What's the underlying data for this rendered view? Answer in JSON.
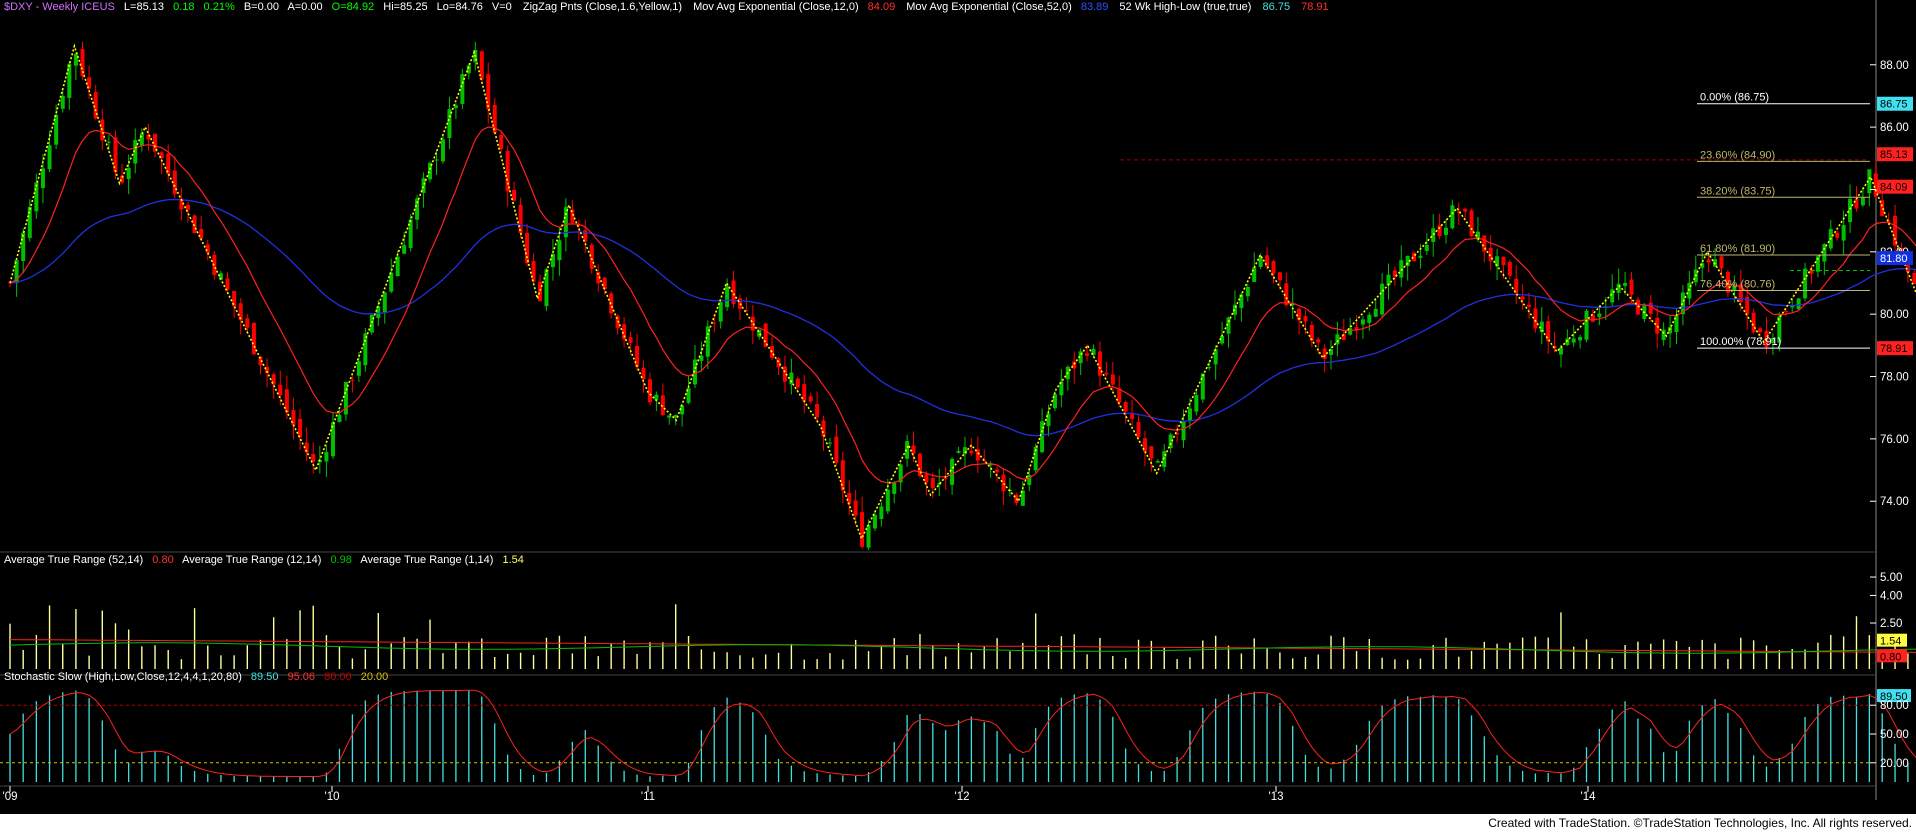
{
  "header": {
    "symbol": "$DXY - Weekly  ICEUS",
    "last": "L=85.13",
    "change": "0.18",
    "change_pct": "0.21%",
    "bid": "B=0.00",
    "ask": "A=0.00",
    "open": "O=84.92",
    "high": "Hi=85.25",
    "low": "Lo=84.76",
    "volume": "V=0",
    "zigzag": "ZigZag Pnts (Close,1.6,Yellow,1)",
    "ema12_label": "Mov Avg Exponential (Close,12,0)",
    "ema12_value": "84.09",
    "ema52_label": "Mov Avg Exponential (Close,52,0)",
    "ema52_value": "83.89",
    "hilo_label": "52 Wk High-Low (true,true)",
    "hilo_high": "86.75",
    "hilo_low": "78.91"
  },
  "atr_header": {
    "atr52_label": "Average True Range (52,14)",
    "atr52_value": "0.80",
    "atr12_label": "Average True Range (12,14)",
    "atr12_value": "0.98",
    "atr1_label": "Average True Range (1,14)",
    "atr1_value": "1.54"
  },
  "stoch_header": {
    "label": "Stochastic Slow (High,Low,Close,12,4,4,1,20,80)",
    "k_value": "89.50",
    "d_value": "95.06",
    "ob_value": "80.00",
    "os_value": "20.00"
  },
  "footer": {
    "credit": "Created with TradeStation. ©TradeStation Technologies, Inc. All rights reserved."
  },
  "colors": {
    "up_candle": "#00c000",
    "down_candle": "#ff0000",
    "ema12": "#ff2020",
    "ema52": "#2030e0",
    "zigzag": "#ffff00",
    "fib": "#bdb76b",
    "atr_bars": "#ffff99",
    "stoch": "#40e0e0"
  },
  "chart_data": [
    {
      "type": "candlestick",
      "title": "$DXY - Weekly",
      "x_ticks": [
        "'09",
        "'10",
        "'11",
        "'12",
        "'13",
        "'14"
      ],
      "ylim": [
        72.5,
        89.5
      ],
      "y_ticks": [
        "88.00",
        "86.00",
        "84.00",
        "82.00",
        "80.00",
        "78.00",
        "76.00",
        "74.00"
      ],
      "price_tags": [
        {
          "value": "86.75",
          "kind": "high"
        },
        {
          "value": "85.13",
          "kind": "last"
        },
        {
          "value": "84.09",
          "kind": "ema12"
        },
        {
          "value": "81.80",
          "kind": "ema52"
        },
        {
          "value": "78.91",
          "kind": "low"
        }
      ],
      "fib_levels": [
        {
          "label": "0.00% (86.75)",
          "value": 86.75
        },
        {
          "label": "23.60% (84.90)",
          "value": 84.9
        },
        {
          "label": "38.20% (83.75)",
          "value": 83.75
        },
        {
          "label": "61.80% (81.90)",
          "value": 81.9
        },
        {
          "label": "76.40% (80.76)",
          "value": 80.76
        },
        {
          "label": "100.00% (78.91)",
          "value": 78.91
        }
      ],
      "zigzag_points": [
        [
          0.0,
          81.0
        ],
        [
          0.2,
          88.6
        ],
        [
          0.34,
          84.2
        ],
        [
          0.42,
          86.0
        ],
        [
          0.95,
          75.0
        ],
        [
          1.45,
          88.4
        ],
        [
          1.6,
          82.5
        ],
        [
          1.65,
          80.5
        ],
        [
          1.75,
          83.5
        ],
        [
          2.0,
          77.5
        ],
        [
          2.09,
          76.6
        ],
        [
          2.25,
          81.0
        ],
        [
          2.55,
          76.4
        ],
        [
          2.68,
          72.8
        ],
        [
          2.83,
          75.8
        ],
        [
          2.9,
          74.2
        ],
        [
          3.03,
          75.8
        ],
        [
          3.18,
          74.0
        ],
        [
          3.3,
          77.6
        ],
        [
          3.4,
          79.0
        ],
        [
          3.62,
          74.9
        ],
        [
          3.95,
          81.9
        ],
        [
          4.15,
          78.6
        ],
        [
          4.58,
          83.4
        ],
        [
          4.9,
          78.8
        ],
        [
          5.1,
          80.9
        ],
        [
          5.25,
          79.3
        ],
        [
          5.38,
          82.0
        ],
        [
          5.56,
          79.1
        ],
        [
          5.9,
          84.4
        ],
        [
          6.06,
          80.3
        ],
        [
          6.17,
          83.5
        ],
        [
          6.23,
          82.4
        ],
        [
          6.45,
          79.3
        ],
        [
          6.75,
          81.3
        ],
        [
          7.04,
          79.4
        ],
        [
          7.28,
          86.75
        ],
        [
          7.37,
          85.13
        ]
      ],
      "series_summary": {
        "start": "2009-01",
        "end": "2014-06",
        "last_close": 85.13,
        "high_52wk": 86.75,
        "low_52wk": 78.91
      }
    },
    {
      "type": "bar",
      "title": "Average True Range",
      "ylim": [
        0,
        5.6
      ],
      "y_ticks": [
        "5.00",
        "4.00",
        "2.50",
        "1.54",
        "0.80"
      ],
      "series": [
        {
          "name": "Average True Range (52,14)",
          "last": 0.8
        },
        {
          "name": "Average True Range (12,14)",
          "last": 0.98
        },
        {
          "name": "Average True Range (1,14)",
          "last": 1.54
        }
      ]
    },
    {
      "type": "bar",
      "title": "Stochastic Slow",
      "ylim": [
        0,
        100
      ],
      "y_ticks": [
        "89.50",
        "80.00",
        "50.00",
        "20.00"
      ],
      "series": [
        {
          "name": "SlowK",
          "last": 89.5
        },
        {
          "name": "SlowD",
          "last": 95.06
        }
      ],
      "overbought": 80,
      "oversold": 20
    }
  ]
}
